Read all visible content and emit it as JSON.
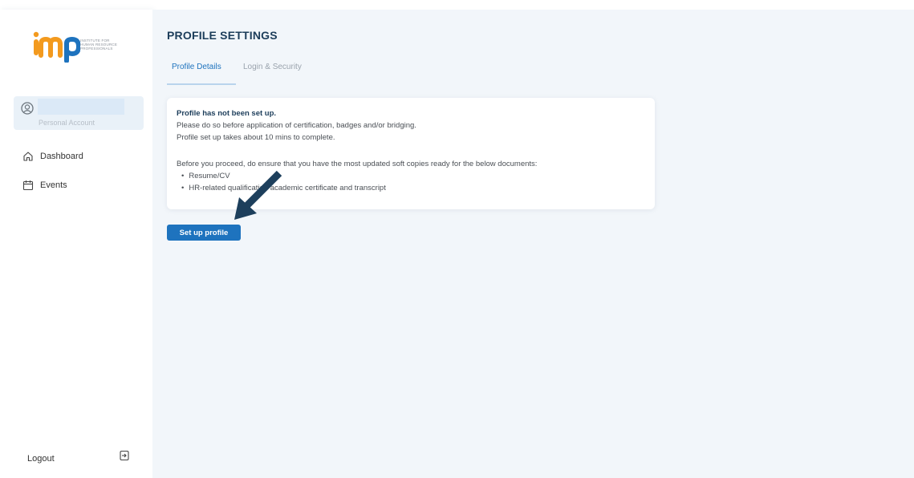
{
  "colors": {
    "accent": "#1e73be",
    "main_bg": "#f2f6fa",
    "title": "#1c3d5a",
    "logo_orange": "#f39a1e",
    "logo_blue": "#1e73be"
  },
  "sidebar": {
    "logo_text": "imp",
    "logo_org_lines": [
      "INSTITUTE FOR",
      "HUMAN RESOURCE",
      "PROFESSIONALS"
    ],
    "account_type": "Personal Account",
    "nav": [
      {
        "label": "Dashboard",
        "icon": "home-icon"
      },
      {
        "label": "Events",
        "icon": "calendar-icon"
      }
    ],
    "logout_label": "Logout",
    "logout_icon": "logout-icon"
  },
  "main": {
    "title": "PROFILE SETTINGS",
    "tabs": [
      {
        "label": "Profile Details",
        "active": true
      },
      {
        "label": "Login & Security",
        "active": false
      }
    ],
    "notice": {
      "title": "Profile has not been set up.",
      "line1": "Please do so before application of certification, badges and/or bridging.",
      "line2": "Profile set up takes about 10 mins to complete.",
      "line3": "Before you proceed, do ensure that you have the most updated soft copies ready for the below documents:",
      "bullets": [
        "Resume/CV",
        "HR-related qualification academic certificate and transcript"
      ]
    },
    "setup_button": "Set up profile"
  }
}
